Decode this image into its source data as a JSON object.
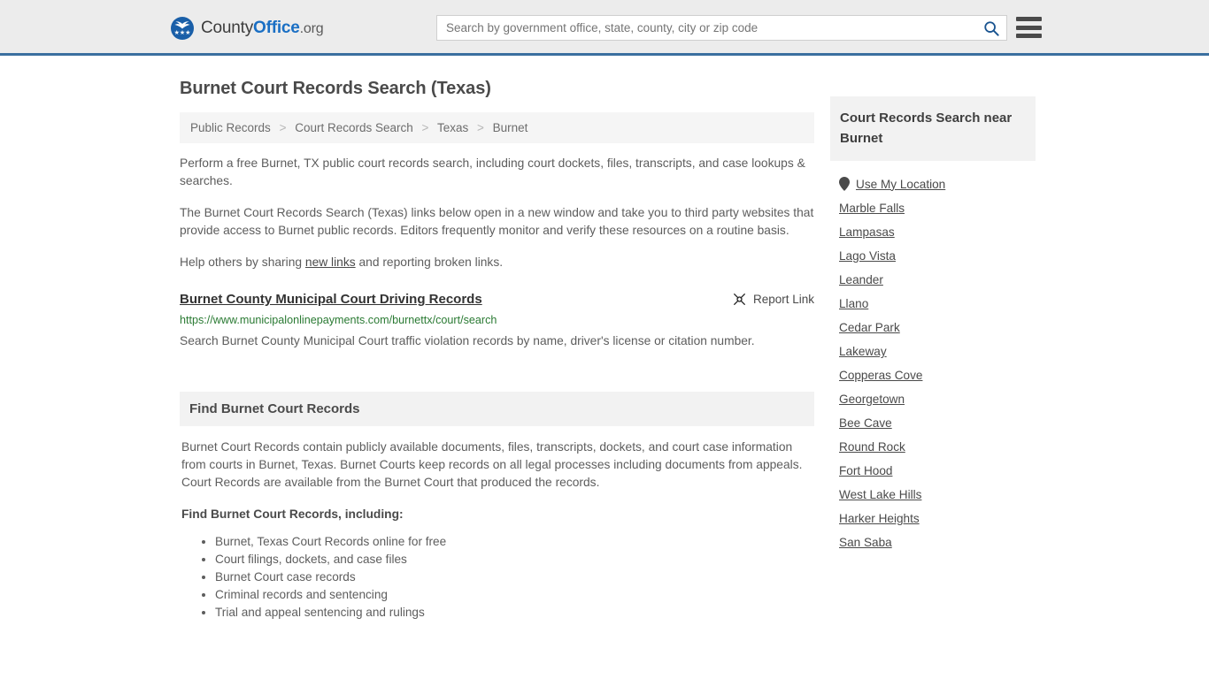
{
  "header": {
    "logo": {
      "text_county": "County",
      "text_office": "Office",
      "text_org": ".org",
      "mark_icon": "eagle-stars-icon",
      "stars": "★★★"
    },
    "search": {
      "placeholder": "Search by government office, state, county, city or zip code",
      "value": "",
      "icon": "search-icon"
    },
    "menu": {
      "icon": "hamburger-menu-icon"
    },
    "accent_color": "#3a6f9f",
    "background_color": "#ececec"
  },
  "main": {
    "title": "Burnet Court Records Search (Texas)",
    "breadcrumb": {
      "separator": ">",
      "items": [
        {
          "label": "Public Records"
        },
        {
          "label": "Court Records Search"
        },
        {
          "label": "Texas"
        },
        {
          "label": "Burnet"
        }
      ]
    },
    "paragraphs": {
      "intro": "Perform a free Burnet, TX public court records search, including court dockets, files, transcripts, and case lookups & searches.",
      "disclaimer": "The Burnet Court Records Search (Texas) links below open in a new window and take you to third party websites that provide access to Burnet public records. Editors frequently monitor and verify these resources on a routine basis.",
      "share_prefix": "Help others by sharing ",
      "share_link": "new links",
      "share_suffix": " and reporting broken links."
    },
    "results": [
      {
        "title": "Burnet County Municipal Court Driving Records",
        "url": "https://www.municipalonlinepayments.com/burnettx/court/search",
        "description": "Search Burnet County Municipal Court traffic violation records by name, driver's license or citation number.",
        "report_label": "Report Link",
        "report_icon": "broken-link-icon"
      }
    ],
    "panel": {
      "header": "Find Burnet Court Records",
      "description": "Burnet Court Records contain publicly available documents, files, transcripts, dockets, and court case information from courts in Burnet, Texas. Burnet Courts keep records on all legal processes including documents from appeals. Court Records are available from the Burnet Court that produced the records.",
      "list_lead": "Find Burnet Court Records, including:",
      "list_items": [
        "Burnet, Texas Court Records online for free",
        "Court filings, dockets, and case files",
        "Burnet Court case records",
        "Criminal records and sentencing",
        "Trial and appeal sentencing and rulings"
      ]
    }
  },
  "sidebar": {
    "header": "Court Records Search near Burnet",
    "use_my_location": {
      "label": "Use My Location",
      "icon": "map-pin-icon"
    },
    "items": [
      {
        "label": "Marble Falls"
      },
      {
        "label": "Lampasas"
      },
      {
        "label": "Lago Vista"
      },
      {
        "label": "Leander"
      },
      {
        "label": "Llano"
      },
      {
        "label": "Cedar Park"
      },
      {
        "label": "Lakeway"
      },
      {
        "label": "Copperas Cove"
      },
      {
        "label": "Georgetown"
      },
      {
        "label": "Bee Cave"
      },
      {
        "label": "Round Rock"
      },
      {
        "label": "Fort Hood"
      },
      {
        "label": "West Lake Hills"
      },
      {
        "label": "Harker Heights"
      },
      {
        "label": "San Saba"
      }
    ]
  }
}
